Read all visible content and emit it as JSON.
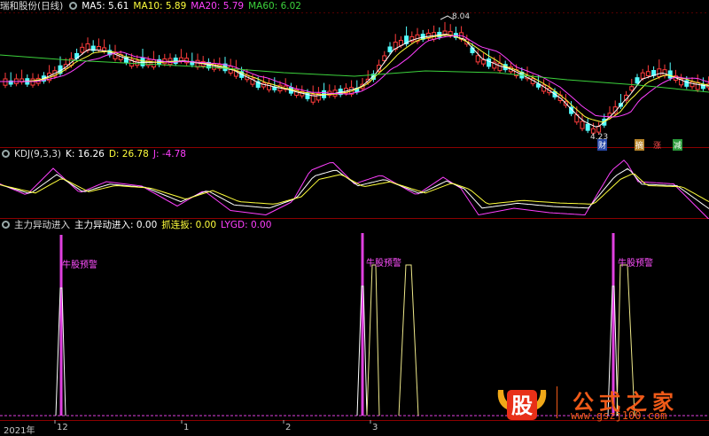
{
  "price_panel": {
    "name": "瑞和股份(日线)",
    "ma": [
      {
        "label": "MA5: 5.61",
        "color": "#ffffff"
      },
      {
        "label": "MA10: 5.89",
        "color": "#ffff3c"
      },
      {
        "label": "MA20: 5.79",
        "color": "#ff40ff"
      },
      {
        "label": "MA60: 6.02",
        "color": "#3cd23c"
      }
    ],
    "high_label": "8.04",
    "low_label": "4.23",
    "badges": [
      "财",
      "摘",
      "涨",
      "减"
    ]
  },
  "kdj_panel": {
    "name": "KDJ(9,3,3)",
    "k": "K: 16.26",
    "d": "D: 26.78",
    "j": "J: -4.78"
  },
  "signal_panel": {
    "name": "主力异动进入",
    "v1": "主力异动进入: 0.00",
    "v2": "抓连扳: 0.00",
    "v3": "LYGD: 0.00",
    "alert": "牛股预警"
  },
  "xaxis": {
    "year": "2021年",
    "months": [
      "12",
      "1",
      "2",
      "3"
    ]
  },
  "watermark": {
    "logo_char": "股",
    "title": "公式之家",
    "url": "www.gszj100.com"
  },
  "colors": {
    "up": "#ff3c3c",
    "down": "#54ffff",
    "ma5": "#ffffff",
    "ma10": "#ffff3c",
    "ma20": "#ff40ff",
    "ma60": "#3cd23c",
    "grid": "#8b0000",
    "signal": "#e040e0"
  }
}
